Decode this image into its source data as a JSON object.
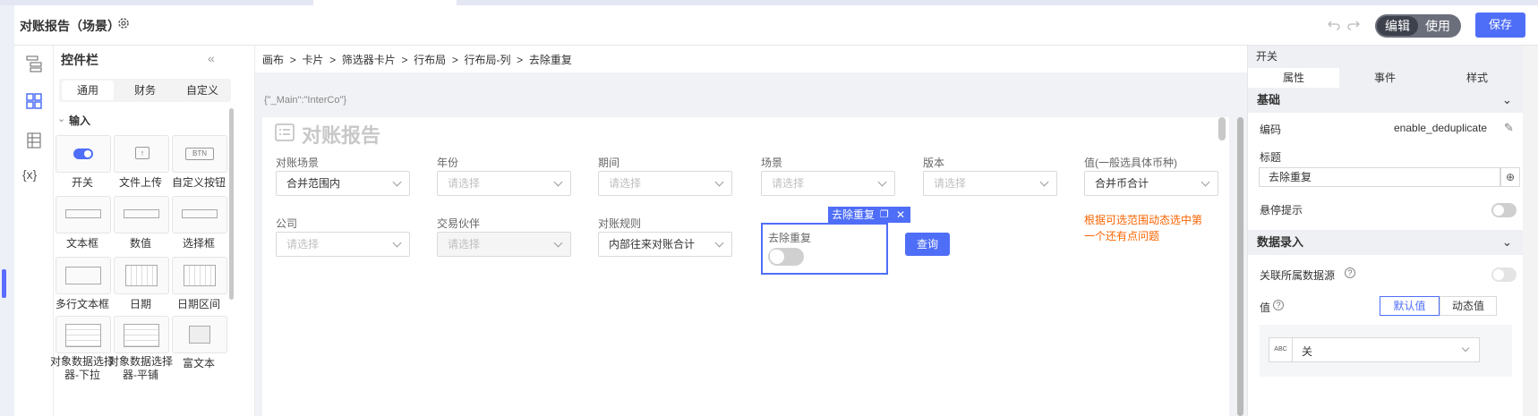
{
  "app": {
    "title": "对账报告（场景）",
    "edit_label": "编辑",
    "use_label": "使用",
    "save_label": "保存"
  },
  "panel": {
    "title": "控件栏",
    "tabs": [
      "通用",
      "财务",
      "自定义"
    ],
    "section": "输入",
    "widgets": [
      "开关",
      "文件上传",
      "自定义按钮",
      "文本框",
      "数值",
      "选择框",
      "多行文本框",
      "日期",
      "日期区间",
      "对象数据选择器-下拉",
      "对象数据选择器-平铺",
      "富文本"
    ]
  },
  "breadcrumb": [
    "画布",
    ">",
    "卡片",
    ">",
    "筛选器卡片",
    ">",
    "行布局",
    ">",
    "行布局-列",
    ">",
    "去除重复"
  ],
  "canvas": {
    "json_text": "{\"_Main\":\"InterCo\"}",
    "report_title": "对账报告",
    "filters": [
      {
        "label": "对账场景",
        "value": "合并范围内",
        "placeholder": false
      },
      {
        "label": "年份",
        "value": "请选择",
        "placeholder": true
      },
      {
        "label": "期间",
        "value": "请选择",
        "placeholder": true
      },
      {
        "label": "场景",
        "value": "请选择",
        "placeholder": true
      },
      {
        "label": "版本",
        "value": "请选择",
        "placeholder": true
      },
      {
        "label": "值(一般选具体币种)",
        "value": "合并币合计",
        "placeholder": false
      },
      {
        "label": "公司",
        "value": "请选择",
        "placeholder": true
      },
      {
        "label": "交易伙伴",
        "value": "请选择",
        "placeholder": true,
        "disabled": true
      },
      {
        "label": "对账规则",
        "value": "内部往来对账合计",
        "placeholder": false
      }
    ],
    "dedup_label": "去除重复",
    "selected_tag": "去除重复",
    "query_label": "查询",
    "note": "根据可选范围动态选中第一个还有点问题"
  },
  "right": {
    "title": "开关",
    "tabs": [
      "属性",
      "事件",
      "样式"
    ],
    "section_basic": "基础",
    "code_label": "编码",
    "code_value": "enable_deduplicate",
    "title_label": "标题",
    "title_value": "去除重复",
    "hover_label": "悬停提示",
    "section_data": "数据录入",
    "assoc_label": "关联所属数据源",
    "value_label": "值",
    "default_value": "默认值",
    "dynamic_value": "动态值",
    "abc": "ABC",
    "select_value": "关"
  },
  "colors": {
    "accent": "#4f6ef7",
    "warning": "#fa6400"
  }
}
